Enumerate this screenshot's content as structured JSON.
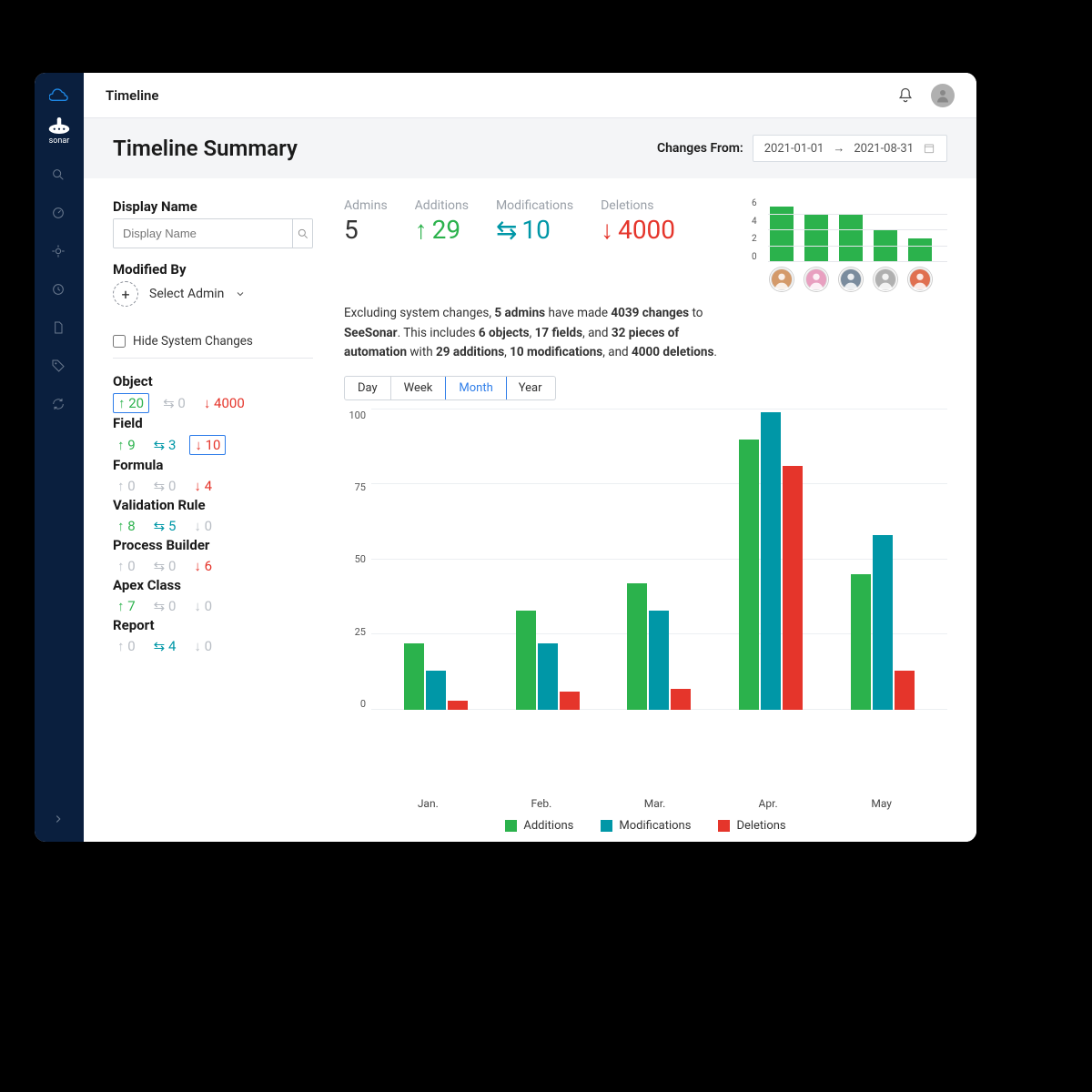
{
  "header": {
    "page_title": "Timeline"
  },
  "sidebar": {
    "logo_text": "sonar"
  },
  "summary": {
    "title": "Timeline Summary",
    "date_label": "Changes From:",
    "date_from": "2021-01-01",
    "date_to": "2021-08-31"
  },
  "filters": {
    "display_name_label": "Display Name",
    "display_name_placeholder": "Display Name",
    "modified_by_label": "Modified By",
    "select_admin": "Select Admin",
    "hide_label": "Hide System Changes"
  },
  "categories": [
    {
      "name": "Object",
      "add": "20",
      "mod": "0",
      "del": "4000",
      "add_muted": false,
      "mod_muted": true,
      "del_muted": false,
      "box": "add"
    },
    {
      "name": "Field",
      "add": "9",
      "mod": "3",
      "del": "10",
      "add_muted": false,
      "mod_muted": false,
      "del_muted": false,
      "box": "del"
    },
    {
      "name": "Formula",
      "add": "0",
      "mod": "0",
      "del": "4",
      "add_muted": true,
      "mod_muted": true,
      "del_muted": false,
      "box": ""
    },
    {
      "name": "Validation Rule",
      "add": "8",
      "mod": "5",
      "del": "0",
      "add_muted": false,
      "mod_muted": false,
      "del_muted": true,
      "box": ""
    },
    {
      "name": "Process Builder",
      "add": "0",
      "mod": "0",
      "del": "6",
      "add_muted": true,
      "mod_muted": true,
      "del_muted": false,
      "box": ""
    },
    {
      "name": "Apex Class",
      "add": "7",
      "mod": "0",
      "del": "0",
      "add_muted": false,
      "mod_muted": true,
      "del_muted": true,
      "box": ""
    },
    {
      "name": "Report",
      "add": "0",
      "mod": "4",
      "del": "0",
      "add_muted": true,
      "mod_muted": false,
      "del_muted": true,
      "box": ""
    }
  ],
  "metrics": {
    "admins_label": "Admins",
    "admins": "5",
    "additions_label": "Additions",
    "additions": "29",
    "mods_label": "Modifications",
    "mods": "10",
    "deletions_label": "Deletions",
    "deletions": "4000"
  },
  "description": {
    "p1a": "Excluding system changes, ",
    "b1": "5 admins",
    "p1b": " have made ",
    "b2": "4039 changes",
    "p1c": " to ",
    "b3": "SeeSonar",
    "p1d": ". This includes ",
    "b4": "6 objects",
    "p1e": ", ",
    "b5": "17 fields",
    "p1f": ", and ",
    "b6": "32 pieces of automation",
    "p1g": " with ",
    "b7": "29 additions",
    "p1h": ", ",
    "b8": "10 modifications",
    "p1i": ", and ",
    "b9": "4000 deletions",
    "p1j": "."
  },
  "tabs": [
    "Day",
    "Week",
    "Month",
    "Year"
  ],
  "active_tab": "Month",
  "legend": {
    "add": "Additions",
    "mod": "Modifications",
    "del": "Deletions"
  },
  "chart_data": [
    {
      "type": "bar",
      "title": "Changes per admin",
      "xlabel": "",
      "ylabel": "",
      "ylim": [
        0,
        8
      ],
      "yticks": [
        0,
        2,
        4,
        6
      ],
      "categories": [
        "Admin 1",
        "Admin 2",
        "Admin 3",
        "Admin 4",
        "Admin 5"
      ],
      "values": [
        7,
        6,
        6,
        4,
        3
      ]
    },
    {
      "type": "bar",
      "title": "Changes by month",
      "xlabel": "",
      "ylabel": "",
      "ylim": [
        0,
        100
      ],
      "yticks": [
        0,
        25,
        50,
        75,
        100
      ],
      "categories": [
        "Jan.",
        "Feb.",
        "Mar.",
        "Apr.",
        "May"
      ],
      "series": [
        {
          "name": "Additions",
          "color": "#2bb24c",
          "values": [
            22,
            33,
            42,
            90,
            45
          ]
        },
        {
          "name": "Modifications",
          "color": "#0097a7",
          "values": [
            13,
            22,
            33,
            99,
            58
          ]
        },
        {
          "name": "Deletions",
          "color": "#e5352b",
          "values": [
            3,
            6,
            7,
            81,
            13
          ]
        }
      ]
    }
  ]
}
